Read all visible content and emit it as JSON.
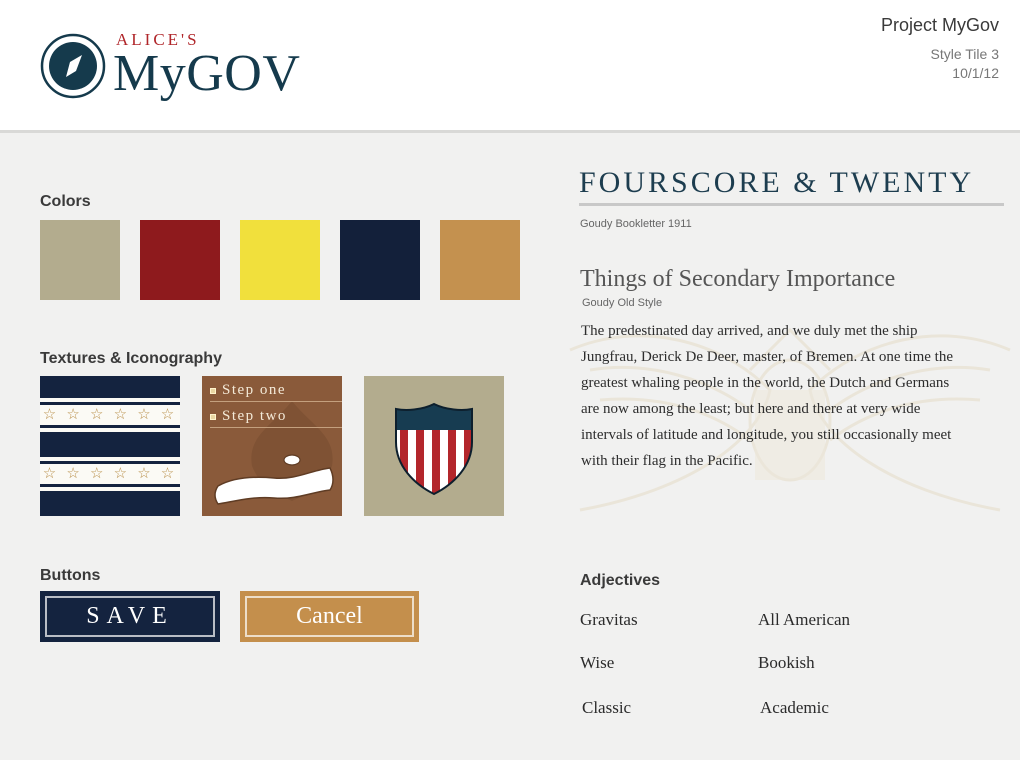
{
  "header": {
    "logo_kicker": "ALICE'S",
    "logo_word": "MyGOV",
    "project_title": "Project MyGov",
    "style_tile": "Style Tile 3",
    "date": "10/1/12"
  },
  "colors": {
    "heading": "Colors",
    "swatches": [
      "#b3ac8e",
      "#8e1a1d",
      "#f1e03c",
      "#13203a",
      "#c4914f"
    ]
  },
  "textures": {
    "heading": "Textures & Iconography",
    "stars": "☆ ☆ ☆ ☆ ☆ ☆",
    "steps": [
      "Step one",
      "Step two"
    ]
  },
  "buttons": {
    "heading": "Buttons",
    "save_label": "SAVE",
    "cancel_label": "Cancel"
  },
  "typography": {
    "headline": "FOURSCORE & TWENTY",
    "headline_font": "Goudy Bookletter 1911",
    "subhead": "Things of Secondary Importance",
    "subhead_font": "Goudy Old Style",
    "body_lines": [
      "The predestinated day arrived, and we duly met the ship",
      "Jungfrau, Derick De Deer, master, of Bremen. At one time the",
      "greatest whaling people in the world, the Dutch and Germans",
      "are now among the least; but here and there at very wide",
      "intervals of latitude and longitude, you still occasionally meet",
      "with their flag in the Pacific."
    ]
  },
  "adjectives": {
    "heading": "Adjectives",
    "items": [
      "Gravitas",
      "All American",
      "Wise",
      "Bookish",
      "Classic",
      "Academic"
    ]
  }
}
